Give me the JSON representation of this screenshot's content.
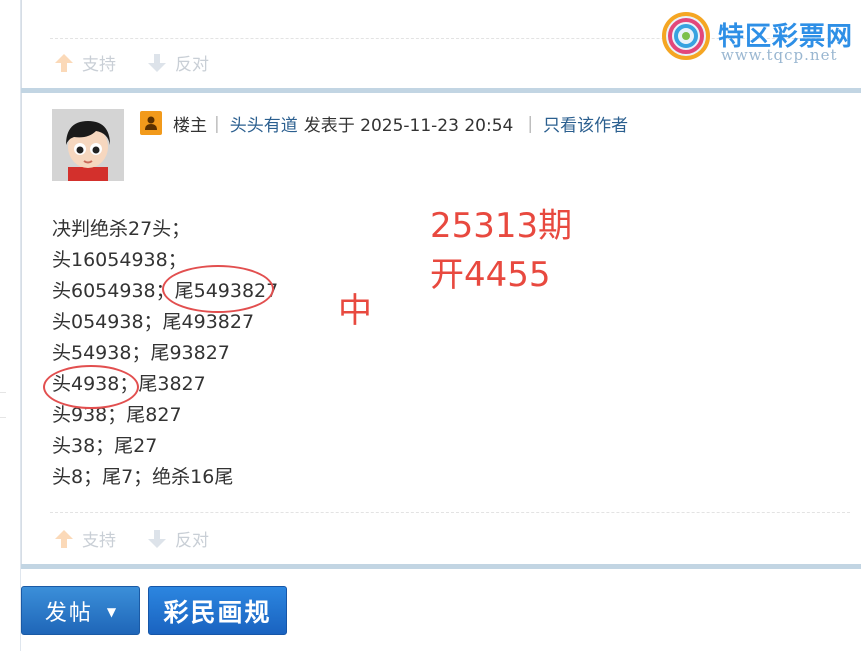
{
  "site_logo": {
    "name": "特区彩票网",
    "url": "www.tqcp.net"
  },
  "post_a": {
    "vote_support": "支持",
    "vote_oppose": "反对"
  },
  "post_b": {
    "role": "楼主",
    "author": "头头有道",
    "posted_at": "发表于 2025-11-23 20:54",
    "only_author_link": "只看该作者",
    "content_lines": [
      "决判绝杀27头；",
      "头16054938；",
      "头6054938；尾5493827",
      "头054938；尾493827",
      "头54938；尾93827",
      "头4938；尾3827",
      "头938；尾827",
      "头38；尾27",
      "头8；尾7；绝杀16尾"
    ],
    "annotation_period": "25313期",
    "annotation_result": "开4455",
    "annotation_hit": "中",
    "vote_support": "支持",
    "vote_oppose": "反对"
  },
  "footer": {
    "post_button": "发帖",
    "rules_button": "彩民画规"
  },
  "colors": {
    "annotation_red": "#e8493f",
    "link_blue": "#2b5f8f",
    "button_blue": "#1f66b8"
  }
}
